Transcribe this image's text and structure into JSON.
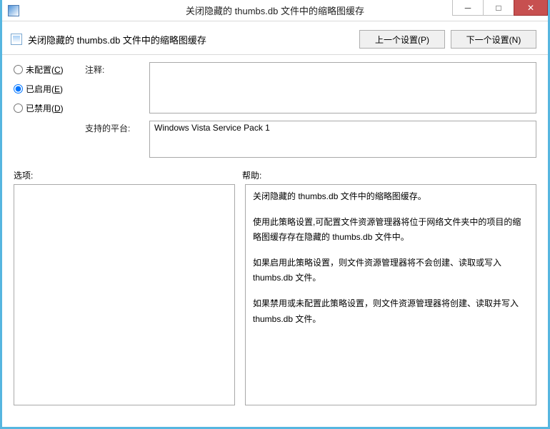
{
  "window": {
    "title": "关闭隐藏的 thumbs.db 文件中的缩略图缓存",
    "minimize": "─",
    "maximize": "□",
    "close": "✕"
  },
  "header": {
    "title": "关闭隐藏的 thumbs.db 文件中的缩略图缓存",
    "prev_btn": "上一个设置(P)",
    "next_btn": "下一个设置(N)"
  },
  "radios": {
    "not_configured": "未配置(",
    "not_configured_key": "C",
    "not_configured_suffix": ")",
    "enabled": "已启用(",
    "enabled_key": "E",
    "enabled_suffix": ")",
    "disabled": "已禁用(",
    "disabled_key": "D",
    "disabled_suffix": ")",
    "selected": "enabled"
  },
  "fields": {
    "comment_label": "注释:",
    "comment_value": "",
    "platform_label": "支持的平台:",
    "platform_value": "Windows Vista Service Pack 1"
  },
  "sections": {
    "options_label": "选项:",
    "help_label": "帮助:"
  },
  "help": {
    "p1": "关闭隐藏的 thumbs.db 文件中的缩略图缓存。",
    "p2": "使用此策略设置,可配置文件资源管理器将位于网络文件夹中的项目的缩略图缓存存在隐藏的 thumbs.db 文件中。",
    "p3": "如果启用此策略设置，则文件资源管理器将不会创建、读取或写入 thumbs.db 文件。",
    "p4": "如果禁用或未配置此策略设置，则文件资源管理器将创建、读取并写入 thumbs.db 文件。"
  }
}
